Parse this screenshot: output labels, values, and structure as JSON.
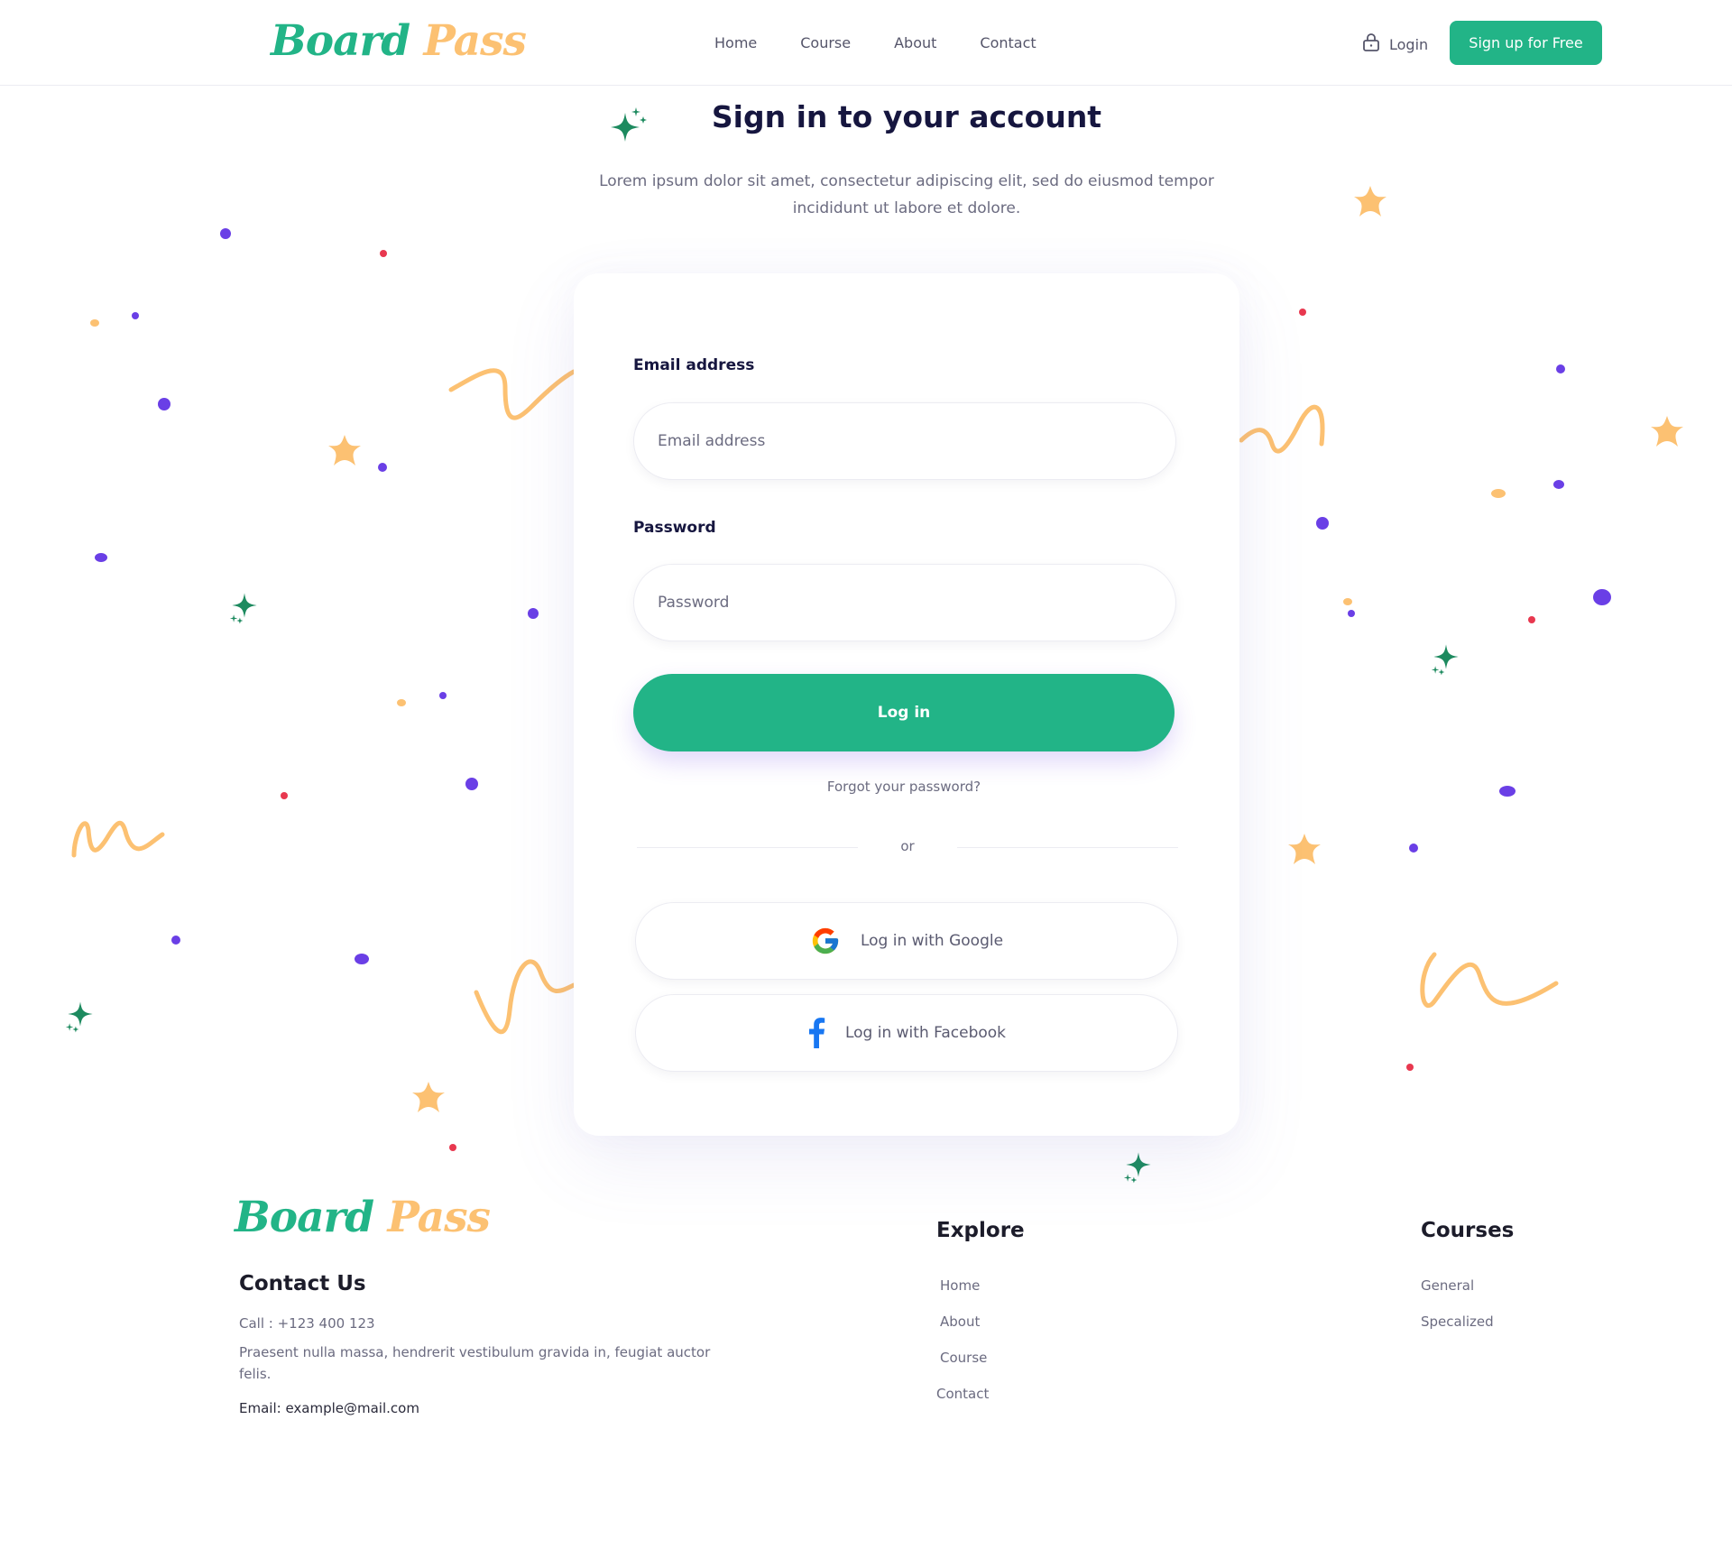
{
  "brand": {
    "word1": "Board",
    "word2": "Pass"
  },
  "nav": {
    "items": [
      "Home",
      "Course",
      "About",
      "Contact"
    ]
  },
  "header": {
    "login_label": "Login",
    "signup_label": "Sign up for Free"
  },
  "hero": {
    "title": "Sign in to your account",
    "subtitle": "Lorem ipsum dolor sit amet, consectetur adipiscing elit, sed do eiusmod tempor incididunt ut labore et dolore."
  },
  "form": {
    "email_label": "Email address",
    "email_placeholder": "Email address",
    "password_label": "Password",
    "password_placeholder": "Password",
    "submit_label": "Log in",
    "forgot_label": "Forgot your password?",
    "divider_label": "or",
    "google_label": "Log in with Google",
    "facebook_label": "Log in with Facebook"
  },
  "footer": {
    "contact_title": "Contact Us",
    "phone": "Call : +123 400 123",
    "description": "Praesent nulla massa, hendrerit vestibulum gravida in, feugiat auctor felis.",
    "email": "Email: example@mail.com",
    "explore_title": "Explore",
    "explore_items": [
      "Home",
      "About",
      "Course",
      "Contact"
    ],
    "courses_title": "Courses",
    "courses_items": [
      "General",
      "Specalized"
    ]
  },
  "colors": {
    "accent": "#22b487",
    "brand_secondary": "#fcc172",
    "heading": "#16163f",
    "dot_purple": "#6a3fe6",
    "dot_red": "#e8384f",
    "star_green": "#1d8a5f"
  },
  "icons": [
    "lock-icon",
    "google-icon",
    "facebook-icon",
    "sparkle-icon",
    "star-icon"
  ]
}
